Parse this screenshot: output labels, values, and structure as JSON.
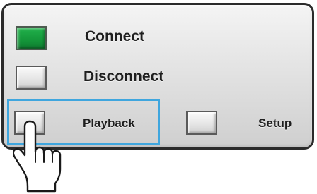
{
  "panel": {
    "connect": {
      "label": "Connect",
      "state": "on",
      "color": "#17a23f"
    },
    "disconnect": {
      "label": "Disconnect"
    },
    "playback": {
      "label": "Playback",
      "highlighted": true,
      "highlight_color": "#3fa6de"
    },
    "setup": {
      "label": "Setup"
    }
  },
  "pointer": {
    "icon": "hand-pointer-icon"
  }
}
